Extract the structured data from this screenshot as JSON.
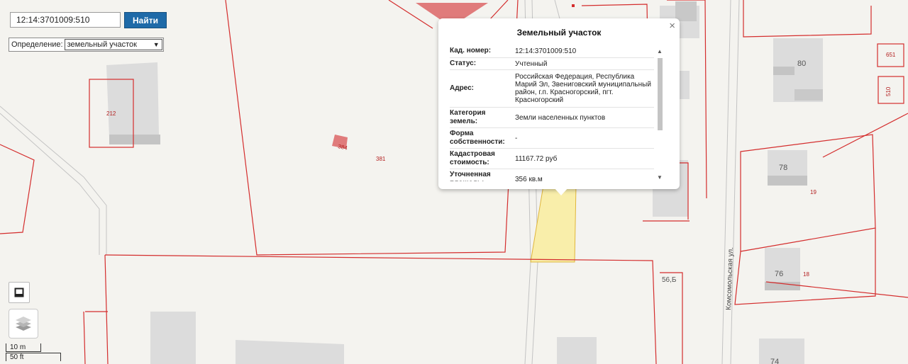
{
  "search": {
    "value": "12:14:3701009:510",
    "button_label": "Найти"
  },
  "definition": {
    "label": "Определение:",
    "selected": "земельный участок"
  },
  "map_labels": {
    "parcel_212": "212",
    "parcel_384": "384",
    "parcel_381": "381",
    "parcel_651": "651",
    "parcel_510": "510",
    "parcel_19": "19",
    "parcel_18": "18",
    "building_80": "80",
    "building_78": "78",
    "building_76": "76",
    "building_56b": "56,Б",
    "building_74": "74",
    "street": "Комсомольская ул."
  },
  "scale": {
    "metric": "10 m",
    "imperial": "50 ft"
  },
  "popup": {
    "title": "Земельный участок",
    "close": "×",
    "rows": [
      {
        "key": "Кад. номер:",
        "value": "12:14:3701009:510"
      },
      {
        "key": "Статус:",
        "value": "Учтенный"
      },
      {
        "key": "Адрес:",
        "value": "Российская Федерация, Республика Марий Эл, Звениговский муниципальный район, г.п. Красногорский, пгт. Красногорский"
      },
      {
        "key": "Категория земель:",
        "value": "Земли населенных пунктов"
      },
      {
        "key": "Форма собственности:",
        "value": "-"
      },
      {
        "key": "Кадастровая стоимость:",
        "value": "11167.72 руб"
      },
      {
        "key": "Уточненная площадь:",
        "value": "356 кв.м"
      }
    ]
  },
  "icons": {
    "dropdown": "chevron-down-icon",
    "fullscreen": "fullscreen-icon",
    "layers": "layers-icon",
    "scroll_up": "scroll-up-icon",
    "scroll_down": "scroll-down-icon"
  },
  "colors": {
    "parcel_border": "#d42d2d",
    "selected_parcel": "#f9eeaa",
    "building": "#dcdcdc",
    "button": "#1e6aa8"
  }
}
